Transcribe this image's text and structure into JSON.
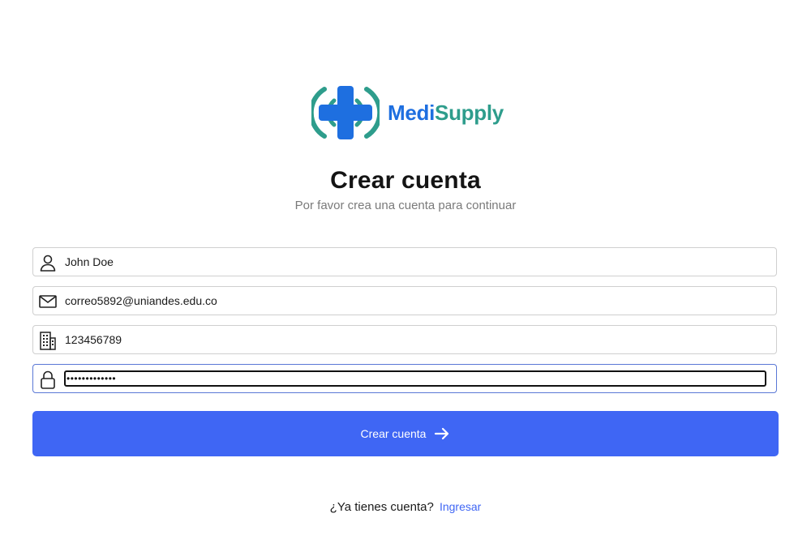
{
  "brand": {
    "name_part1": "Medi",
    "name_part2": "Supply",
    "colors": {
      "blue": "#1e6fe0",
      "teal": "#2e9d8c"
    }
  },
  "header": {
    "title": "Crear cuenta",
    "subtitle": "Por favor crea una cuenta para continuar"
  },
  "form": {
    "name": {
      "value": "John Doe",
      "icon": "user-icon"
    },
    "email": {
      "value": "correo5892@uniandes.edu.co",
      "icon": "mail-icon"
    },
    "tax_id": {
      "value": "123456789",
      "icon": "building-icon"
    },
    "password": {
      "value": "•••••••••••••",
      "icon": "lock-icon",
      "focused": true
    },
    "submit_label": "Crear cuenta",
    "submit_icon": "arrow-right-icon",
    "accent_color": "#3f66f4"
  },
  "footer": {
    "prompt": "¿Ya tienes cuenta?",
    "link_label": "Ingresar"
  }
}
